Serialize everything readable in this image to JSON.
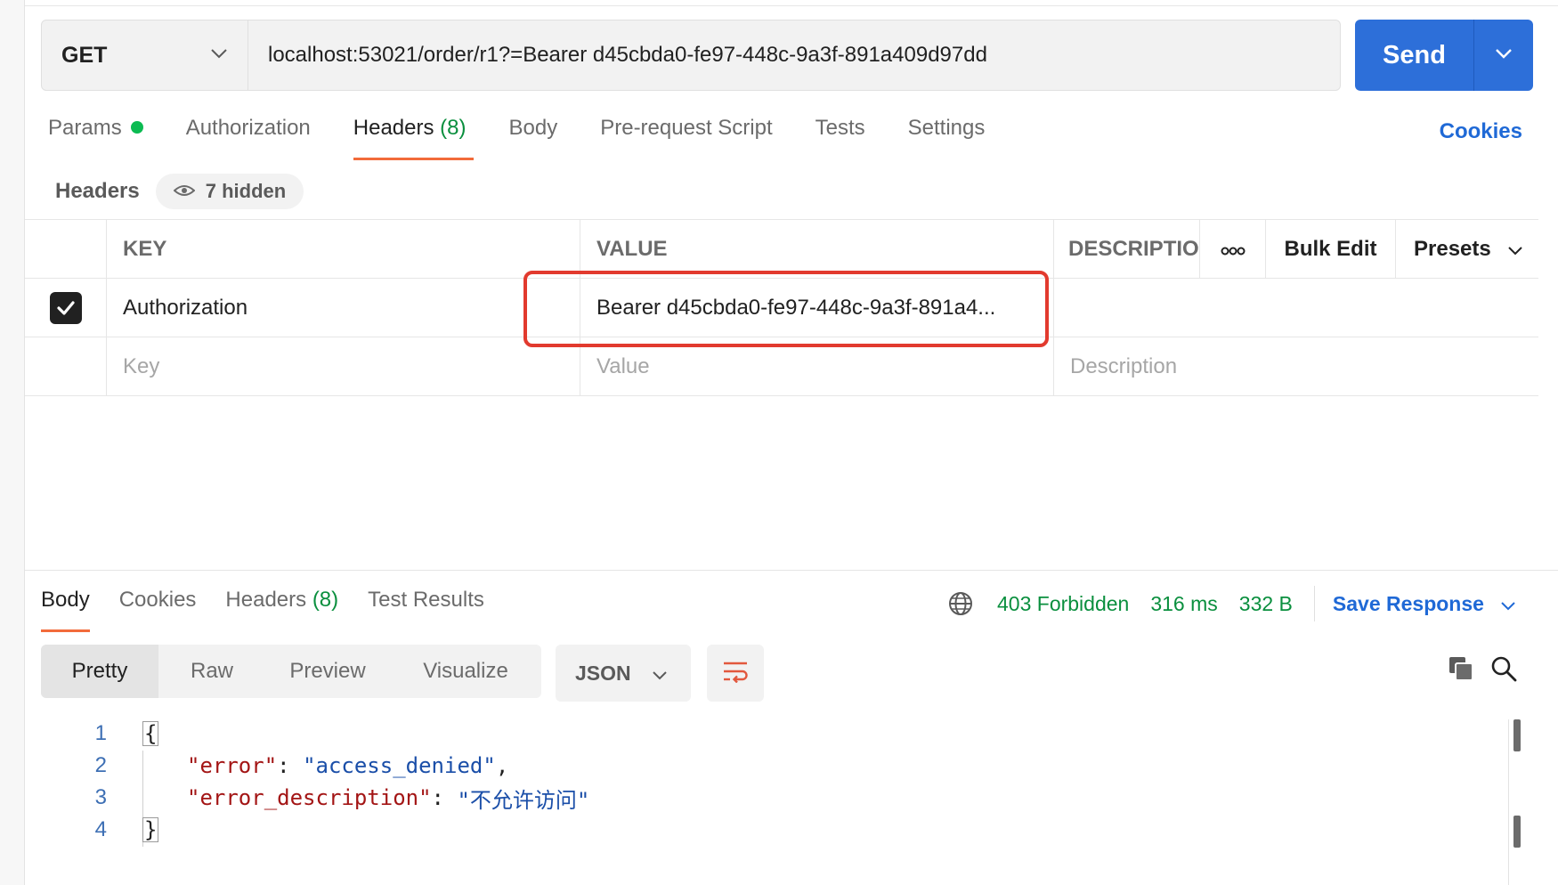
{
  "request": {
    "method": "GET",
    "url": "localhost:53021/order/r1?=Bearer d45cbda0-fe97-448c-9a3f-891a409d97dd",
    "send_label": "Send"
  },
  "request_tabs": [
    {
      "label": "Params",
      "has_dot": true
    },
    {
      "label": "Authorization"
    },
    {
      "label": "Headers",
      "count": "(8)",
      "active": true
    },
    {
      "label": "Body"
    },
    {
      "label": "Pre-request Script"
    },
    {
      "label": "Tests"
    },
    {
      "label": "Settings"
    }
  ],
  "cookies_link": "Cookies",
  "headers_section": {
    "title": "Headers",
    "hidden_label": "7 hidden"
  },
  "headers_table": {
    "columns": {
      "key": "KEY",
      "value": "VALUE",
      "description": "DESCRIPTIO",
      "more": "ooo",
      "bulk_edit": "Bulk Edit",
      "presets": "Presets"
    },
    "rows": [
      {
        "checked": true,
        "key": "Authorization",
        "value": "Bearer d45cbda0-fe97-448c-9a3f-891a4...",
        "description": ""
      }
    ],
    "placeholders": {
      "key": "Key",
      "value": "Value",
      "description": "Description"
    }
  },
  "response_tabs": [
    {
      "label": "Body",
      "active": true
    },
    {
      "label": "Cookies"
    },
    {
      "label": "Headers",
      "count": "(8)"
    },
    {
      "label": "Test Results"
    }
  ],
  "response_meta": {
    "status": "403 Forbidden",
    "time": "316 ms",
    "size": "332 B",
    "save_label": "Save Response"
  },
  "view_modes": [
    "Pretty",
    "Raw",
    "Preview",
    "Visualize"
  ],
  "format": "JSON",
  "code_lines": [
    {
      "num": "1"
    },
    {
      "num": "2",
      "key": "\"error\"",
      "value": "\"access_denied\"",
      "trail": ","
    },
    {
      "num": "3",
      "key": "\"error_description\"",
      "value": "\"不允许访问\"",
      "trail": ""
    },
    {
      "num": "4"
    }
  ],
  "code_braces": {
    "open": "{",
    "close": "}"
  },
  "colors": {
    "accent_blue": "#2d6fd9",
    "tab_underline": "#f26b3a",
    "status_green": "#0a8f3e",
    "highlight_red": "#e23a2e"
  }
}
